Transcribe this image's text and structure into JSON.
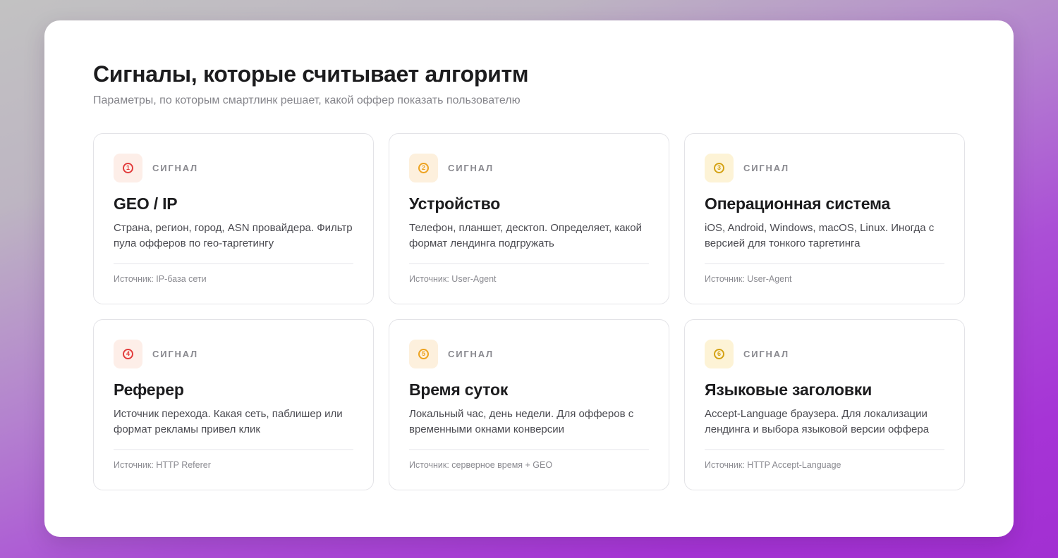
{
  "header": {
    "title": "Сигналы, которые считывает алгоритм",
    "subtitle": "Параметры, по которым смартлинк решает, какой оффер показать пользователю"
  },
  "cards": [
    {
      "number": "1",
      "icon": "number-1-circle-icon",
      "badge_bg": "#fdeee8",
      "badge_color": "#e23c3c",
      "label": "Сигнал",
      "title": "GEO / IP",
      "description": "Страна, регион, город, ASN провайдера. Фильтр пула офферов по гео-таргетингу",
      "source": "Источник: IP-база сети"
    },
    {
      "number": "2",
      "icon": "number-2-circle-icon",
      "badge_bg": "#fdf0dd",
      "badge_color": "#eda21f",
      "label": "Сигнал",
      "title": "Устройство",
      "description": "Телефон, планшет, десктоп. Определяет, какой формат лендинга подгружать",
      "source": "Источник: User-Agent"
    },
    {
      "number": "3",
      "icon": "number-3-circle-icon",
      "badge_bg": "#fdf3d6",
      "badge_color": "#d4a215",
      "label": "Сигнал",
      "title": "Операционная система",
      "description": "iOS, Android, Windows, macOS, Linux. Иногда с версией для тонкого таргетинга",
      "source": "Источник: User-Agent"
    },
    {
      "number": "4",
      "icon": "number-4-circle-icon",
      "badge_bg": "#fdeee8",
      "badge_color": "#e23c3c",
      "label": "Сигнал",
      "title": "Реферер",
      "description": "Источник перехода. Какая сеть, паблишер или формат рекламы привел клик",
      "source": "Источник: HTTP Referer"
    },
    {
      "number": "5",
      "icon": "number-5-circle-icon",
      "badge_bg": "#fdf0dd",
      "badge_color": "#eda21f",
      "label": "Сигнал",
      "title": "Время суток",
      "description": "Локальный час, день недели. Для офферов с временными окнами конверсии",
      "source": "Источник: серверное время + GEO"
    },
    {
      "number": "6",
      "icon": "number-6-circle-icon",
      "badge_bg": "#fdf3d6",
      "badge_color": "#d4a215",
      "label": "Сигнал",
      "title": "Языковые заголовки",
      "description": "Accept-Language браузера. Для локализации лендинга и выбора языковой версии оффера",
      "source": "Источник: HTTP Accept-Language"
    }
  ]
}
